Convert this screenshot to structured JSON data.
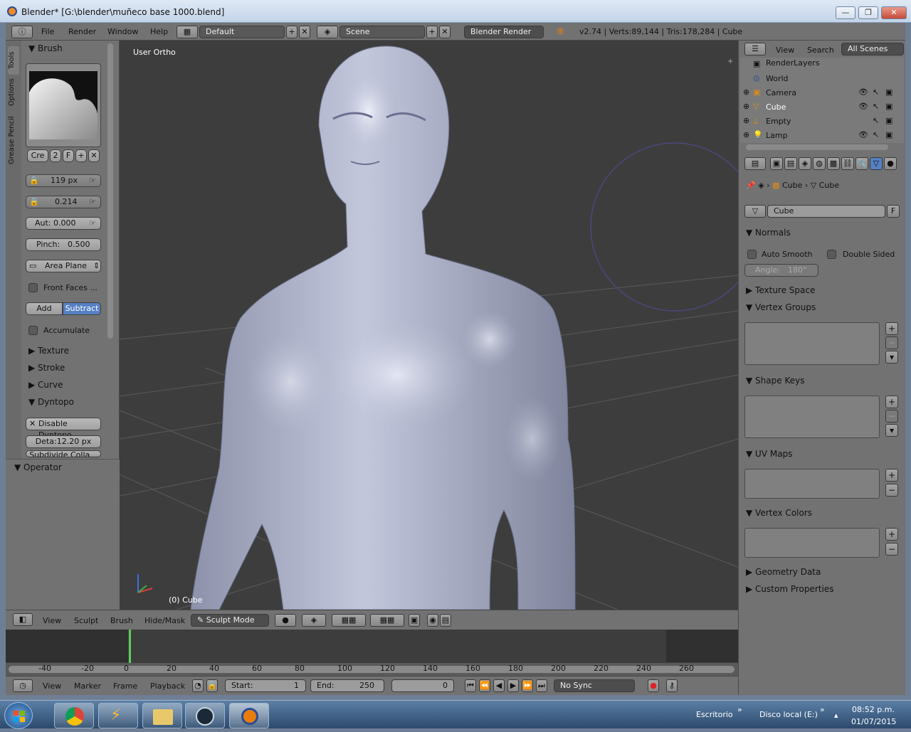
{
  "window": {
    "title": "Blender* [G:\\blender\\muñeco base 1000.blend]",
    "min": "—",
    "max": "❐",
    "close": "✕"
  },
  "topbar": {
    "menus": [
      "File",
      "Render",
      "Window",
      "Help"
    ],
    "layout": "Default",
    "scene": "Scene",
    "engine": "Blender Render",
    "stats": "v2.74 | Verts:89,144 | Tris:178,284 | Cube"
  },
  "toolshelf": {
    "tabs": [
      "Tools",
      "Options",
      "Grease Pencil"
    ],
    "brush_header": "Brush",
    "brush_name": "Cre",
    "brush_users": "2",
    "brush_fake": "F",
    "radius": "119 px",
    "strength": "0.214",
    "autosmooth": "Aut: 0.000",
    "pinch_label": "Pinch:",
    "pinch_value": "0.500",
    "sculpt_plane": "Area Plane",
    "front_faces": "Front Faces ...",
    "add": "Add",
    "subtract": "Subtract",
    "accumulate": "Accumulate",
    "sections": [
      "Texture",
      "Stroke",
      "Curve"
    ],
    "dyntopo": "Dyntopo",
    "disable_dyntopo": "Disable Dyntopo",
    "detail": "Deta:12.20 px",
    "subdivide": "Subdivide Colla...",
    "operator": "Operator"
  },
  "viewport": {
    "view_label": "User Ortho",
    "object_label": "(0) Cube"
  },
  "view3d_header": {
    "menus": [
      "View",
      "Sculpt",
      "Brush",
      "Hide/Mask"
    ],
    "mode": "Sculpt Mode"
  },
  "timeline": {
    "ticks": [
      "-40",
      "-20",
      "0",
      "20",
      "40",
      "60",
      "80",
      "100",
      "120",
      "140",
      "160",
      "180",
      "200",
      "220",
      "240",
      "260"
    ],
    "menus": [
      "View",
      "Marker",
      "Frame",
      "Playback"
    ],
    "start_label": "Start:",
    "start_value": "1",
    "end_label": "End:",
    "end_value": "250",
    "current": "0",
    "sync": "No Sync"
  },
  "outliner": {
    "menus": [
      "View",
      "Search"
    ],
    "filter": "All Scenes",
    "items": [
      {
        "label": "RenderLayers"
      },
      {
        "label": "World"
      },
      {
        "label": "Camera"
      },
      {
        "label": "Cube"
      },
      {
        "label": "Empty"
      },
      {
        "label": "Lamp"
      }
    ]
  },
  "properties": {
    "breadcrumb_object": "Cube",
    "breadcrumb_mesh": "Cube",
    "mesh_name": "Cube",
    "mesh_fake": "F",
    "normals": "Normals",
    "auto_smooth": "Auto Smooth",
    "double_sided": "Double Sided",
    "angle_label": "Angle:",
    "angle_value": "180°",
    "texture_space": "Texture Space",
    "vertex_groups": "Vertex Groups",
    "shape_keys": "Shape Keys",
    "uv_maps": "UV Maps",
    "vertex_colors": "Vertex Colors",
    "geometry_data": "Geometry Data",
    "custom_properties": "Custom Properties"
  },
  "taskbar": {
    "tray1": "Escritorio",
    "tray2": "Disco local (E:)",
    "time": "08:52 p.m.",
    "date": "01/07/2015"
  },
  "colors": {
    "panel": "#727272",
    "viewport": "#3d3d3d",
    "accent": "#5680c2",
    "mesh": "#a9aec5"
  }
}
